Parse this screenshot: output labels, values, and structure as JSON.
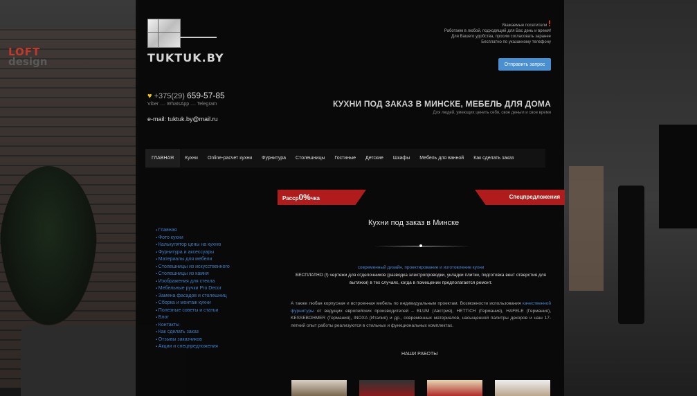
{
  "background": {
    "logo_line1": "LOFT",
    "logo_line2": "design"
  },
  "header": {
    "site_name": "TUKTUK.BY",
    "phone_prefix": "+375(29)",
    "phone_number": "659-57-85",
    "messengers": "Viber .... WhatsApp .... Telegram",
    "email": "e-mail: tuktuk.by@mail.ru",
    "notice_title": "Уважаемые посетители",
    "notice_mark": "!",
    "notice_lines": [
      "Работаем в любой, подходящий для Вас день и время!",
      "Для Вашего удобства, просим согласовать заранее",
      "Бесплатно по указанному телефону"
    ],
    "send_button": "Отправить запрос",
    "headline": "КУХНИ ПОД ЗАКАЗ В МИНСКЕ, МЕБЕЛЬ ДЛЯ ДОМА",
    "subline": "Для людей, умеющих ценить себя, свое деньги и свое время"
  },
  "nav": {
    "items": [
      "ГЛАВНАЯ",
      "Кухни",
      "Online-расчет кухни",
      "Фурнитура",
      "Столешницы",
      "Гостиные",
      "Детские",
      "Шкафы",
      "Мебель для ванной",
      "Как сделать заказ"
    ]
  },
  "ribbons": {
    "left_prefix": "Расср",
    "left_big": "0%",
    "left_suffix": "чка",
    "right": "Спецпредложения"
  },
  "sidebar": {
    "items": [
      "Главная",
      "Фото кухни",
      "Калькулятор цены на кухню",
      "Фурнитура и аксессуары",
      "Материалы для мебели",
      "Столешницы из искусственного",
      "Столешницы из камня",
      "Изображения для стекла",
      "Мебельные ручки Pro Decor",
      "Замена фасадов и столешниц",
      "Сборка и монтаж кухни",
      "Полезные советы и статьи",
      "Блог",
      "Контакты",
      "Как сделать заказ",
      "Отзывы заказчиков",
      "Акции и спецпредложения"
    ]
  },
  "content": {
    "title": "Кухни под заказ в Минске",
    "intro_blue": "современный дизайн, проектирование и изготовление кухни",
    "intro_rest": "БЕСПЛАТНО (!) чертежи для отделочников (разводка электропроводки, укладки плитки, подготовка вент отверстия для вытяжки) в тех случаях, когда в помещении предполагается ремонт.",
    "para_start": "А также любая корпусная и встроенная мебель по индивидуальным проектам. Возможности использования",
    "para_blue": "качественной фурнитуры",
    "para_end": "от ведущих европейских производителей – BLUM (Австрия), HETTICH (Германия), HAFELE (Германия), KESSEBOHMER (Германия), INOXA (Италия) и др., современных материалов, насыщенной палитры декоров и наш 17-летний опыт работы реализуются в стильных и функциональных комплектах.",
    "works_title": "НАШИ РАБОТЫ"
  }
}
